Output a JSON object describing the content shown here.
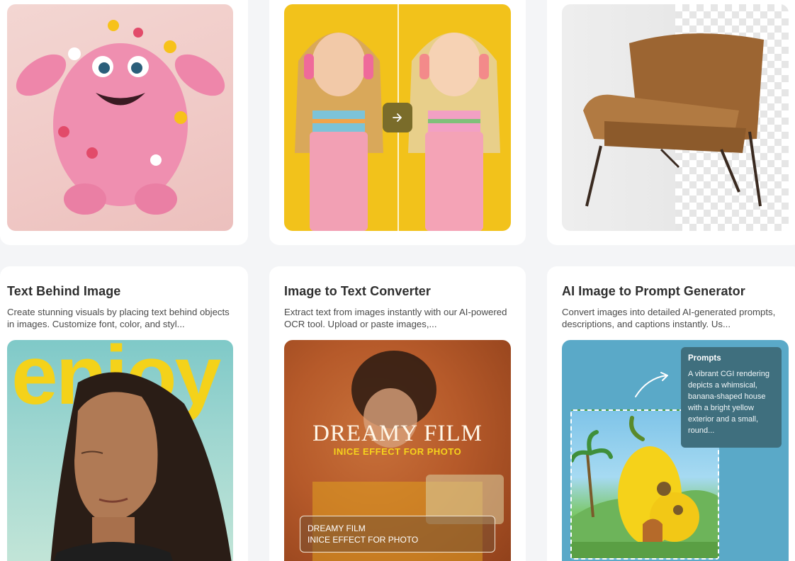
{
  "top_cards": [
    {
      "image": "pink-monster-with-flowers"
    },
    {
      "image": "girl-before-after-comparison",
      "compare_icon": "arrow-right-icon"
    },
    {
      "image": "leather-armchair-background-removed"
    }
  ],
  "cards": [
    {
      "title": "Text Behind Image",
      "description": "Create stunning visuals by placing text behind objects in images. Customize font, color, and styl...",
      "image_text": "enjoy"
    },
    {
      "title": "Image to Text Converter",
      "description": "Extract text from images instantly with our AI-powered OCR tool. Upload or paste images,...",
      "image_title": "DREAMY FILM",
      "image_subtitle": "INICE EFFECT FOR PHOTO",
      "ocr_lines": [
        "DREAMY FILM",
        "INICE EFFECT FOR PHOTO"
      ]
    },
    {
      "title": "AI Image to Prompt Generator",
      "description": "Convert images into detailed AI-generated prompts, descriptions, and captions instantly. Us...",
      "prompt_heading": "Prompts",
      "prompt_text": "A vibrant CGI rendering depicts a whimsical, banana-shaped house with a bright yellow exterior and a small, round..."
    }
  ],
  "colors": {
    "background": "#f4f5f7",
    "card": "#ffffff",
    "enjoy_yellow": "#f4d21a",
    "prompt_panel": "#3f6f7e"
  }
}
